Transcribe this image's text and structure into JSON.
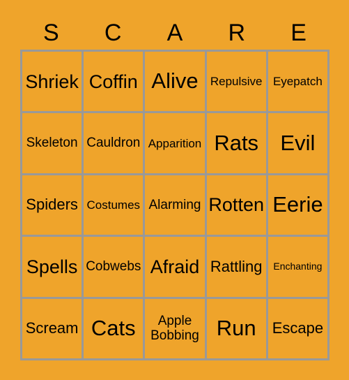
{
  "card": {
    "title_letters": [
      "S",
      "C",
      "A",
      "R",
      "E"
    ],
    "background_color": "#efa42b",
    "grid_line_color": "#999999",
    "text_color": "#000000",
    "rows": 5,
    "columns": 5,
    "cells": [
      [
        {
          "label": "Shriek",
          "size": "lg"
        },
        {
          "label": "Coffin",
          "size": "lg"
        },
        {
          "label": "Alive",
          "size": "xl"
        },
        {
          "label": "Repulsive",
          "size": "xs"
        },
        {
          "label": "Eyepatch",
          "size": "xs"
        }
      ],
      [
        {
          "label": "Skeleton",
          "size": "sm"
        },
        {
          "label": "Cauldron",
          "size": "sm"
        },
        {
          "label": "Apparition",
          "size": "xs"
        },
        {
          "label": "Rats",
          "size": "xl"
        },
        {
          "label": "Evil",
          "size": "xl"
        }
      ],
      [
        {
          "label": "Spiders",
          "size": "md"
        },
        {
          "label": "Costumes",
          "size": "xs"
        },
        {
          "label": "Alarming",
          "size": "sm"
        },
        {
          "label": "Rotten",
          "size": "lg"
        },
        {
          "label": "Eerie",
          "size": "xl"
        }
      ],
      [
        {
          "label": "Spells",
          "size": "lg"
        },
        {
          "label": "Cobwebs",
          "size": "sm"
        },
        {
          "label": "Afraid",
          "size": "lg"
        },
        {
          "label": "Rattling",
          "size": "md"
        },
        {
          "label": "Enchanting",
          "size": "xxs"
        }
      ],
      [
        {
          "label": "Scream",
          "size": "md"
        },
        {
          "label": "Cats",
          "size": "xl"
        },
        {
          "label": "Apple\nBobbing",
          "size": "sm"
        },
        {
          "label": "Run",
          "size": "xl"
        },
        {
          "label": "Escape",
          "size": "md"
        }
      ]
    ]
  }
}
